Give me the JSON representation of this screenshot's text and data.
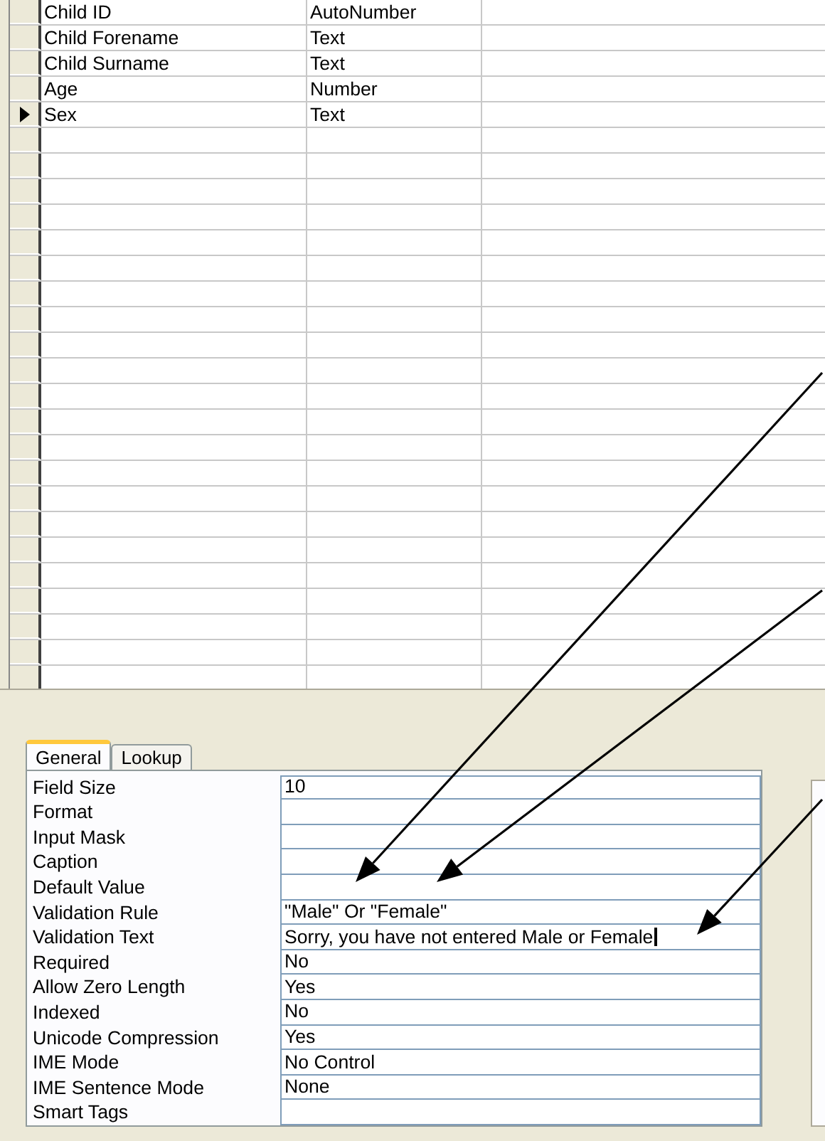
{
  "fields": [
    {
      "field_name": "Child ID",
      "data_type": "AutoNumber",
      "selected": false
    },
    {
      "field_name": "Child Forename",
      "data_type": "Text",
      "selected": false
    },
    {
      "field_name": "Child Surname",
      "data_type": "Text",
      "selected": false
    },
    {
      "field_name": "Age",
      "data_type": "Number",
      "selected": false
    },
    {
      "field_name": "Sex",
      "data_type": "Text",
      "selected": true
    }
  ],
  "tabs": [
    {
      "label": "General",
      "selected": true
    },
    {
      "label": "Lookup",
      "selected": false
    }
  ],
  "properties": [
    {
      "label": "Field Size",
      "value": "10",
      "editing": false
    },
    {
      "label": "Format",
      "editing": false
    },
    {
      "label": "Input Mask",
      "editing": false
    },
    {
      "label": "Caption",
      "editing": false
    },
    {
      "label": "Default Value",
      "editing": false
    },
    {
      "label": "Validation Rule",
      "value": "\"Male\" Or \"Female\"",
      "editing": false
    },
    {
      "label": "Validation Text",
      "value": "Sorry, you have not entered Male or Female",
      "editing": true
    },
    {
      "label": "Required",
      "value": "No",
      "editing": false
    },
    {
      "label": "Allow Zero Length",
      "value": "Yes",
      "editing": false
    },
    {
      "label": "Indexed",
      "value": "No",
      "editing": false
    },
    {
      "label": "Unicode Compression",
      "value": "Yes",
      "editing": false
    },
    {
      "label": "IME Mode",
      "value": "No Control",
      "editing": false
    },
    {
      "label": "IME Sentence Mode",
      "value": "None",
      "editing": false
    },
    {
      "label": "Smart Tags",
      "editing": false
    }
  ]
}
